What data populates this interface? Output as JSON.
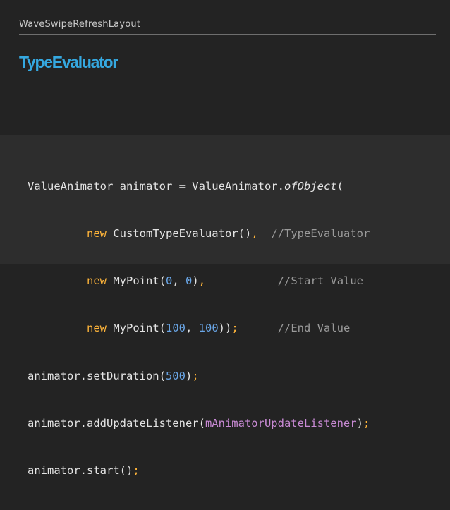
{
  "header": {
    "text": "WaveSwipeRefreshLayout"
  },
  "slide": {
    "title": "TypeEvaluator"
  },
  "code": {
    "l1_a": "ValueAnimator animator = ValueAnimator.",
    "l1_method": "ofObject",
    "l1_b": "(",
    "l2_kw": "new",
    "l2_a": " CustomTypeEvaluator()",
    "l2_comma": ",",
    "l2_comment": "//TypeEvaluator",
    "l3_kw": "new",
    "l3_a": " MyPoint(",
    "l3_n1": "0",
    "l3_sep": ", ",
    "l3_n2": "0",
    "l3_b": ")",
    "l3_comma": ",",
    "l3_comment": "//Start Value",
    "l4_kw": "new",
    "l4_a": " MyPoint(",
    "l4_n1": "100",
    "l4_sep": ", ",
    "l4_n2": "100",
    "l4_b": "))",
    "l4_semi": ";",
    "l4_comment": "//End Value",
    "l5_a": "animator.setDuration(",
    "l5_n": "500",
    "l5_b": ")",
    "l5_semi": ";",
    "l6_a": "animator.addUpdateListener(",
    "l6_var": "mAnimatorUpdateListener",
    "l6_b": ")",
    "l6_semi": ";",
    "l7_a": "animator.start()",
    "l7_semi": ";"
  }
}
